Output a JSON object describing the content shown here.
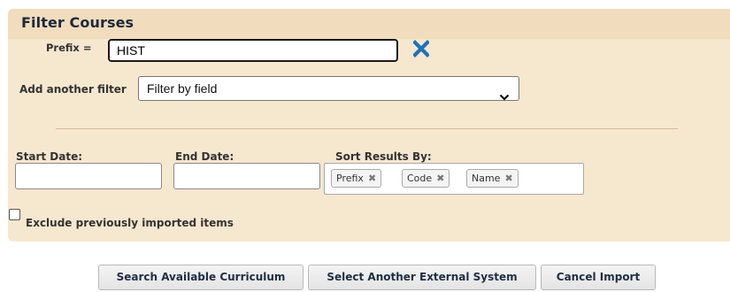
{
  "panel": {
    "title": "Filter Courses"
  },
  "filters": {
    "prefix_label": "Prefix =",
    "prefix_value": "HIST",
    "add_filter_label": "Add another filter",
    "add_filter_selected": "Filter by field",
    "remove_icon": "x-icon",
    "remove_icon_color": "#1f72b8"
  },
  "dates": {
    "start_label": "Start Date:",
    "start_value": "",
    "end_label": "End Date:",
    "end_value": ""
  },
  "sort": {
    "label": "Sort Results By:",
    "chips": [
      {
        "label": "Prefix",
        "remove": "✖"
      },
      {
        "label": "Code",
        "remove": "✖"
      },
      {
        "label": "Name",
        "remove": "✖"
      }
    ]
  },
  "exclude": {
    "label": "Exclude previously imported items",
    "checked": false
  },
  "actions": {
    "search": "Search Available Curriculum",
    "select_system": "Select Another External System",
    "cancel": "Cancel Import"
  },
  "colors": {
    "panel_bg": "#f6e7cf",
    "title_bar_bg": "#f1dcbd",
    "accent_blue": "#1f72b8"
  }
}
